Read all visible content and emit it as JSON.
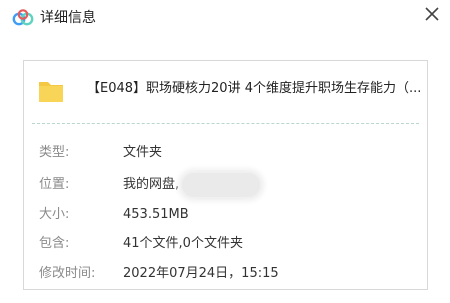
{
  "window": {
    "title": "详细信息"
  },
  "file": {
    "name": "【E048】职场硬核力20讲 4个维度提升职场生存能力（..."
  },
  "details": [
    {
      "label": "类型:",
      "value": "文件夹"
    },
    {
      "label": "位置:",
      "value": "我的网盘,"
    },
    {
      "label": "大小:",
      "value": "453.51MB"
    },
    {
      "label": "包含:",
      "value": "41个文件,0个文件夹"
    },
    {
      "label": "修改时间:",
      "value": "2022年07月24日，15:15"
    }
  ],
  "icons": {
    "app": "cloud-app-icon",
    "close": "close-icon",
    "file": "folder-icon"
  },
  "colors": {
    "folder": "#f5c843",
    "app_blue": "#3f9df5",
    "app_teal": "#5fd2c0",
    "divider": "#b9d6cf"
  }
}
